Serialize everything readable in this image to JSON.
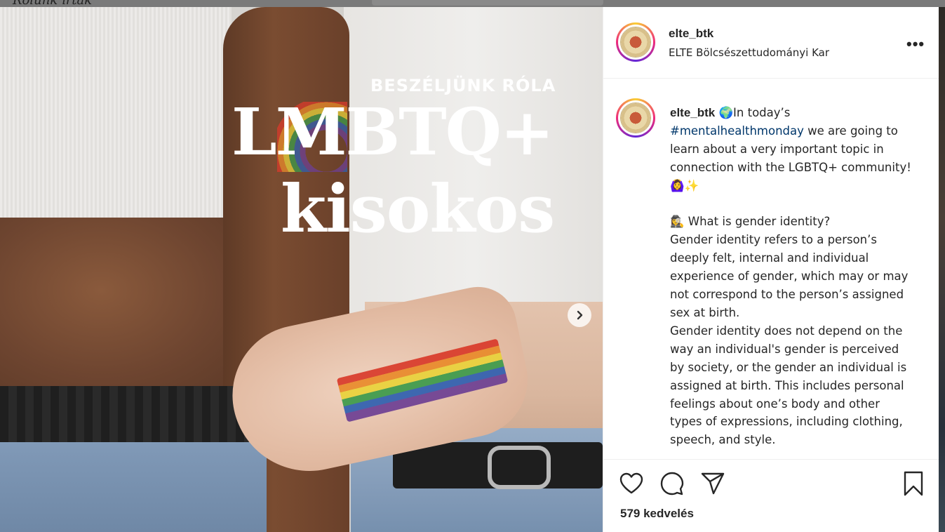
{
  "background_page": {
    "logo_text": "Rólunk írták"
  },
  "post": {
    "media": {
      "overlay_subtitle": "BESZÉLJÜNK RÓLA",
      "overlay_title_line1": "LMBTQ+",
      "overlay_title_line2": "kisokos",
      "next_icon": "chevron-right-icon"
    },
    "header": {
      "username": "elte_btk",
      "full_name": "ELTE Bölcsészettudományi Kar",
      "more_label": "•••"
    },
    "caption": {
      "username": "elte_btk",
      "lead_emoji": "🌍",
      "text_before_hashtag": "In today’s ",
      "hashtag": "#mentalhealthmonday",
      "text_after_hashtag": " we are going to learn about a very important topic in connection with the LGBTQ+ community!🙆‍♀️✨\n\n🕵️‍♀️ What is gender identity?\nGender identity refers to a person’s deeply felt, internal and individual experience of gender, which may or may not correspond to the person’s assigned sex at birth.\nGender identity does not depend on the way an individual's gender is perceived by society, or the gender an individual is assigned at birth. This includes personal feelings about one’s body and other types of expressions, including clothing, speech, and style."
    },
    "actions": {
      "like_icon": "heart-icon",
      "comment_icon": "comment-icon",
      "share_icon": "send-icon",
      "save_icon": "bookmark-icon",
      "likes_text": "579 kedvelés"
    }
  }
}
